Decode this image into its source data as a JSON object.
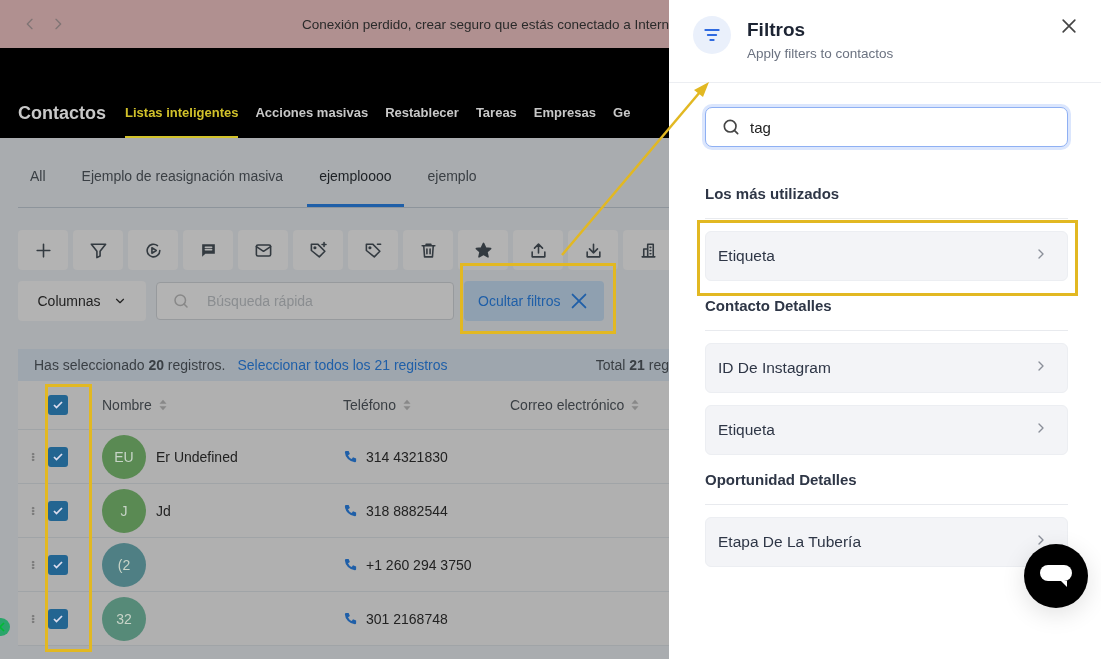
{
  "banner": {
    "message": "Conexión perdido, crear seguro que estás conectado a Intern"
  },
  "nav": {
    "title": "Contactos",
    "items": [
      {
        "label": "Listas inteligentes",
        "selected": true
      },
      {
        "label": "Acciones masivas",
        "selected": false
      },
      {
        "label": "Restablecer",
        "selected": false
      },
      {
        "label": "Tareas",
        "selected": false
      },
      {
        "label": "Empresas",
        "selected": false
      },
      {
        "label": "Ge",
        "selected": false
      }
    ]
  },
  "list_tabs": [
    {
      "label": "All",
      "selected": false
    },
    {
      "label": "Ejemplo de reasignación masiva",
      "selected": false
    },
    {
      "label": "ejemploooo",
      "selected": true
    },
    {
      "label": "ejemplo",
      "selected": false
    }
  ],
  "toolbar": {
    "columns_button": "Columnas",
    "search": {
      "placeholder": "Búsqueda rápida"
    },
    "hide_filters_button": "Ocultar filtros"
  },
  "selection_bar": {
    "message": "Has seleccionado **20** registros.",
    "select_all_link": "Seleccionar todos los 21 registros",
    "total": "Total **21** reg"
  },
  "table": {
    "header_checkbox": {
      "checked": true
    },
    "columns": [
      "Nombre",
      "Teléfono",
      "Correo electrónico"
    ],
    "rows": [
      {
        "initials": "EU",
        "name": "Er Undefined",
        "phone": "314 4321830",
        "checked": true,
        "color": "#5a8a53"
      },
      {
        "initials": "J",
        "name": "Jd",
        "phone": "318 8882544",
        "checked": true,
        "color": "#5a8a53"
      },
      {
        "initials": "(2",
        "name": "",
        "phone": "+1 260 294 3750",
        "checked": true,
        "color": "#4f7f84"
      },
      {
        "initials": "32",
        "name": "",
        "phone": "301 2168748",
        "checked": true,
        "color": "#568a78"
      }
    ]
  },
  "filters_panel": {
    "title": "Filtros",
    "subtitle": "Apply filters to contactos",
    "search": {
      "value": "tag"
    },
    "sections": [
      {
        "title": "Los más utilizados",
        "items": [
          {
            "label": "Etiqueta"
          }
        ]
      },
      {
        "title": "Contacto Detalles",
        "items": [
          {
            "label": "ID De Instagram"
          },
          {
            "label": "Etiqueta"
          }
        ]
      },
      {
        "title": "Oportunidad Detalles",
        "items": [
          {
            "label": "Etapa De La Tubería"
          }
        ]
      }
    ]
  }
}
